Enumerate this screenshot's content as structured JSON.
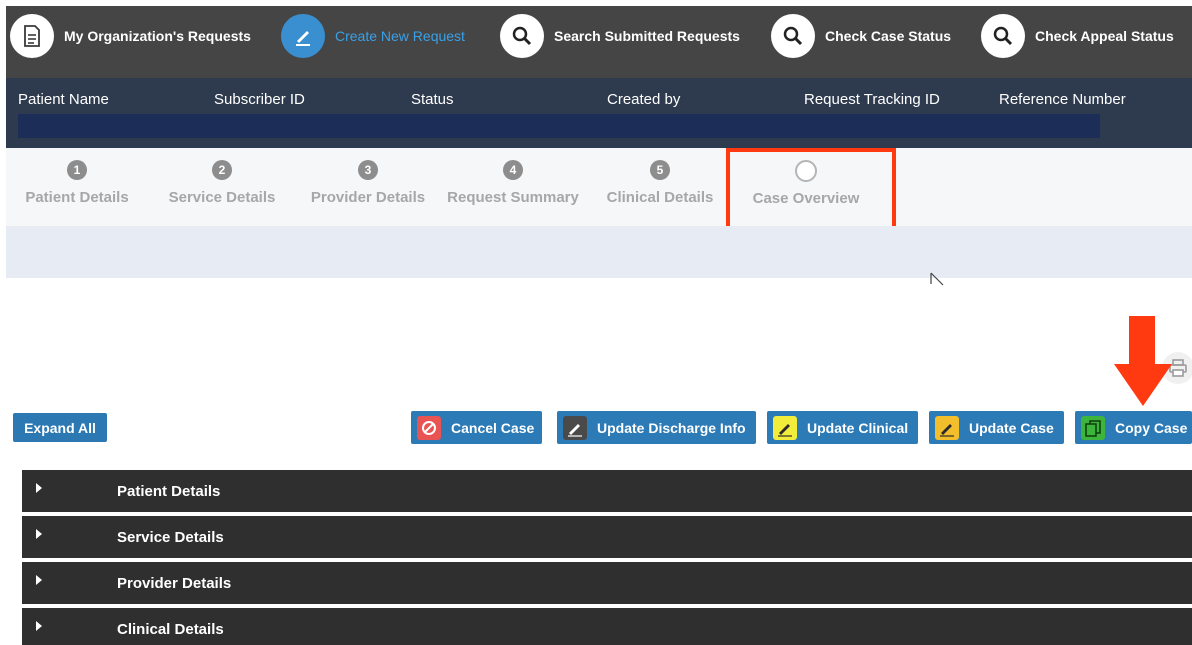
{
  "nav": {
    "items": [
      {
        "label": "My Organization's Requests",
        "icon": "document-icon"
      },
      {
        "label": "Create New Request",
        "icon": "pencil-icon",
        "active": true
      },
      {
        "label": "Search Submitted Requests",
        "icon": "search-icon"
      },
      {
        "label": "Check Case Status",
        "icon": "search-icon"
      },
      {
        "label": "Check Appeal Status",
        "icon": "search-icon"
      }
    ]
  },
  "case_header": {
    "columns": [
      "Patient Name",
      "Subscriber ID",
      "Status",
      "Created by",
      "Request Tracking ID",
      "Reference Number"
    ]
  },
  "stepper": {
    "steps": [
      {
        "number": "1",
        "label": "Patient Details"
      },
      {
        "number": "2",
        "label": "Service Details"
      },
      {
        "number": "3",
        "label": "Provider Details"
      },
      {
        "number": "4",
        "label": "Request Summary"
      },
      {
        "number": "5",
        "label": "Clinical Details"
      },
      {
        "number": "",
        "label": "Case Overview",
        "current": true
      }
    ]
  },
  "actions": {
    "expand_all": "Expand All",
    "cancel_case": "Cancel Case",
    "update_discharge": "Update Discharge Info",
    "update_clinical": "Update Clinical",
    "update_case": "Update Case",
    "copy_case": "Copy Case"
  },
  "sections": [
    "Patient Details",
    "Service Details",
    "Provider Details",
    "Clinical Details"
  ],
  "colors": {
    "nav_bg": "#454545",
    "header_bg": "#2e3a4e",
    "accent_blue": "#2c7ab6",
    "highlight_red": "#ff3a11",
    "accordion_bg": "#2f2f2f"
  }
}
